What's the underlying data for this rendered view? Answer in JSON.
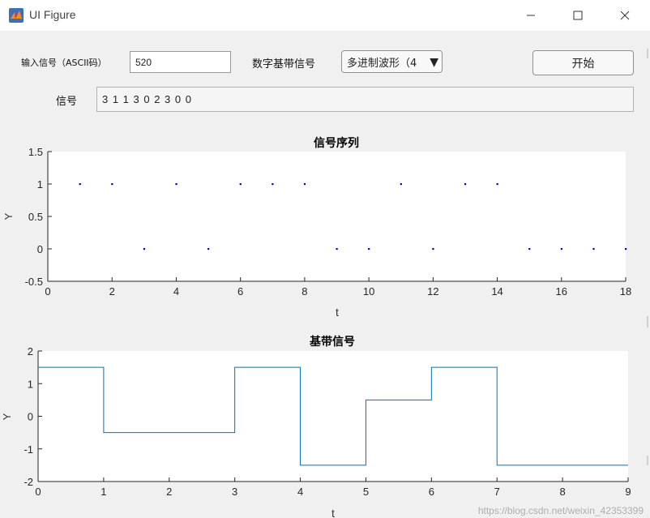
{
  "window": {
    "title": "UI Figure",
    "icon": "matlab-icon",
    "controls": [
      "minimize-icon",
      "maximize-icon",
      "close-icon"
    ]
  },
  "form": {
    "input_label": "输入信号（ASCII码）",
    "input_value": "520",
    "mode_label": "数字基带信号",
    "mode_selected": "多进制波形（4",
    "start_label": "开始",
    "signal_label": "信号",
    "signal_value": "3  1  1  3  0  2  3  0  0"
  },
  "charts": {
    "seq": {
      "title": "信号序列",
      "xlabel": "t",
      "ylabel": "Y"
    },
    "base": {
      "title": "基带信号",
      "xlabel": "t",
      "ylabel": "Y"
    }
  },
  "watermark": "https://blog.csdn.net/weixin_42353399",
  "colors": {
    "accent": "#0072bd",
    "dots": "#0000cc",
    "plot_bg": "#ffffff",
    "figure_bg": "#f0f0f0"
  },
  "chart_data": [
    {
      "type": "scatter",
      "title": "信号序列",
      "xlabel": "t",
      "ylabel": "Y",
      "xlim": [
        0,
        18
      ],
      "ylim": [
        -0.5,
        1.5
      ],
      "xticks": [
        0,
        2,
        4,
        6,
        8,
        10,
        12,
        14,
        16,
        18
      ],
      "yticks": [
        -0.5,
        0,
        0.5,
        1,
        1.5
      ],
      "x": [
        1,
        2,
        3,
        4,
        5,
        6,
        7,
        8,
        9,
        10,
        11,
        12,
        13,
        14,
        15,
        16,
        17,
        18
      ],
      "y": [
        1,
        1,
        0,
        1,
        0,
        1,
        1,
        1,
        0,
        0,
        1,
        0,
        1,
        1,
        0,
        0,
        0,
        0
      ],
      "grid": false
    },
    {
      "type": "line",
      "title": "基带信号",
      "xlabel": "t",
      "ylabel": "Y",
      "xlim": [
        0,
        9
      ],
      "ylim": [
        -2,
        2
      ],
      "xticks": [
        0,
        1,
        2,
        3,
        4,
        5,
        6,
        7,
        8,
        9
      ],
      "yticks": [
        -2,
        -1,
        0,
        1,
        2
      ],
      "x": [
        0,
        1,
        1,
        3,
        3,
        4,
        4,
        5,
        5,
        6,
        6,
        7,
        7,
        9
      ],
      "y": [
        1.5,
        1.5,
        -0.5,
        -0.5,
        1.5,
        1.5,
        -1.5,
        -1.5,
        0.5,
        0.5,
        1.5,
        1.5,
        -1.5,
        -1.5
      ],
      "grid": false
    }
  ]
}
